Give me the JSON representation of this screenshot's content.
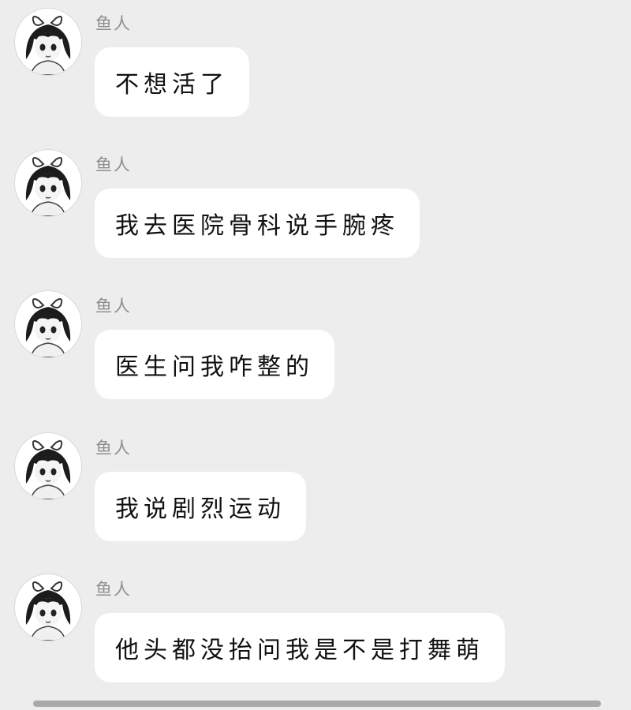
{
  "messages": [
    {
      "sender": "鱼人",
      "avatar_icon": "anime-girl-avatar-icon",
      "text": "不想活了"
    },
    {
      "sender": "鱼人",
      "avatar_icon": "anime-girl-avatar-icon",
      "text": "我去医院骨科说手腕疼"
    },
    {
      "sender": "鱼人",
      "avatar_icon": "anime-girl-avatar-icon",
      "text": "医生问我咋整的"
    },
    {
      "sender": "鱼人",
      "avatar_icon": "anime-girl-avatar-icon",
      "text": "我说剧烈运动"
    },
    {
      "sender": "鱼人",
      "avatar_icon": "anime-girl-avatar-icon",
      "text": "他头都没抬问我是不是打舞萌"
    }
  ],
  "colors": {
    "background": "#ededed",
    "bubble": "#ffffff",
    "sender_text": "#8e8e8e",
    "message_text": "#111111",
    "scrollbar": "#a9a9a9"
  }
}
